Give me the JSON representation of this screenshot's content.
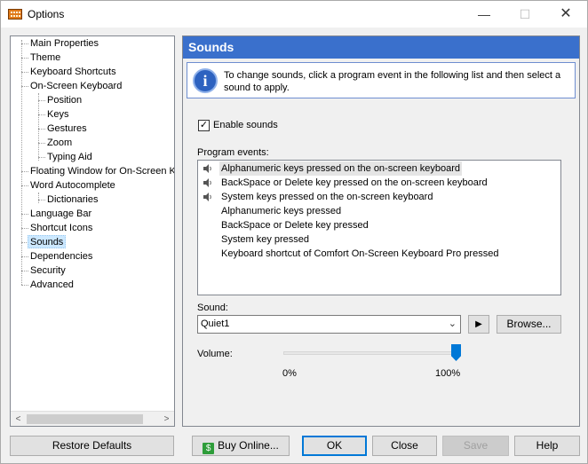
{
  "window": {
    "title": "Options",
    "minimize": "—",
    "maximize": "☐",
    "close": "✕"
  },
  "tree": {
    "items": [
      {
        "label": "Main Properties"
      },
      {
        "label": "Theme"
      },
      {
        "label": "Keyboard Shortcuts"
      },
      {
        "label": "On-Screen Keyboard"
      },
      {
        "label": "Position"
      },
      {
        "label": "Keys"
      },
      {
        "label": "Gestures"
      },
      {
        "label": "Zoom"
      },
      {
        "label": "Typing Aid"
      },
      {
        "label": "Floating Window for On-Screen Ke"
      },
      {
        "label": "Word Autocomplete"
      },
      {
        "label": "Dictionaries"
      },
      {
        "label": "Language Bar"
      },
      {
        "label": "Shortcut Icons"
      },
      {
        "label": "Sounds"
      },
      {
        "label": "Dependencies"
      },
      {
        "label": "Security"
      },
      {
        "label": "Advanced"
      }
    ],
    "selected": "Sounds",
    "scroll_left": "<",
    "scroll_right": ">"
  },
  "sounds": {
    "header": "Sounds",
    "info": "To change sounds, click a program event in the following list and then select a sound to apply.",
    "info_icon": "i",
    "enable_label": "Enable sounds",
    "enable_checked": "✓",
    "events_label": "Program events:",
    "events": [
      {
        "label": "Alphanumeric keys pressed on the on-screen keyboard"
      },
      {
        "label": "BackSpace or Delete key pressed on the on-screen keyboard"
      },
      {
        "label": "System keys pressed on the on-screen keyboard"
      },
      {
        "label": "Alphanumeric keys pressed"
      },
      {
        "label": "BackSpace or Delete key pressed"
      },
      {
        "label": "System key pressed"
      },
      {
        "label": "Keyboard shortcut of Comfort On-Screen Keyboard Pro pressed"
      }
    ],
    "sound_label": "Sound:",
    "sound_value": "Quiet1",
    "play_icon": "▶",
    "browse_label": "Browse...",
    "volume_label": "Volume:",
    "volume_min": "0%",
    "volume_max": "100%",
    "volume_level_percent": 100
  },
  "footer": {
    "restore": "Restore Defaults",
    "buy": "Buy Online...",
    "ok": "OK",
    "close": "Close",
    "save": "Save",
    "help": "Help"
  },
  "colors": {
    "accent": "#3a70cc",
    "selection": "#cce8ff",
    "slider": "#0078d7"
  }
}
